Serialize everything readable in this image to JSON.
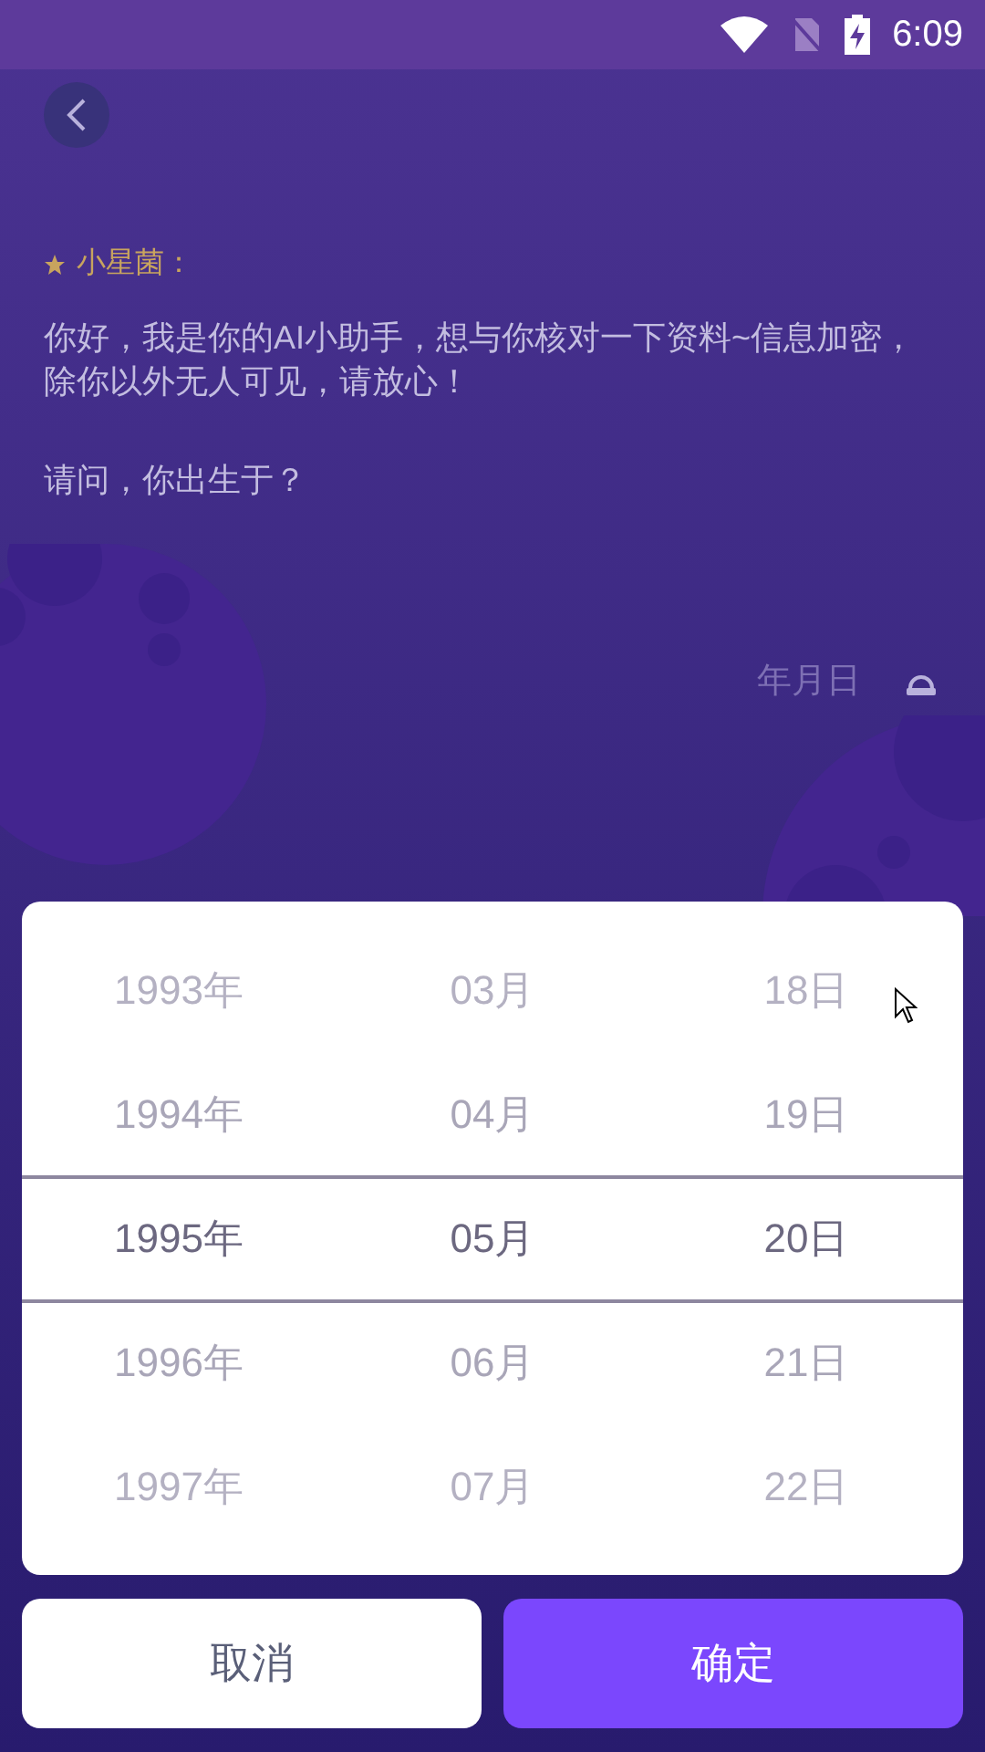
{
  "status_bar": {
    "time": "6:09"
  },
  "assistant": {
    "name": "小星菌：",
    "message": "你好，我是你的AI小助手，想与你核对一下资料~信息加密，除你以外无人可见，请放心！",
    "question": "请问，你出生于？"
  },
  "answer": {
    "placeholder": "年月日"
  },
  "picker": {
    "columns": [
      {
        "items": [
          {
            "label": "1993年",
            "selected": false
          },
          {
            "label": "1994年",
            "selected": false
          },
          {
            "label": "1995年",
            "selected": true
          },
          {
            "label": "1996年",
            "selected": false
          },
          {
            "label": "1997年",
            "selected": false
          }
        ]
      },
      {
        "items": [
          {
            "label": "03月",
            "selected": false
          },
          {
            "label": "04月",
            "selected": false
          },
          {
            "label": "05月",
            "selected": true
          },
          {
            "label": "06月",
            "selected": false
          },
          {
            "label": "07月",
            "selected": false
          }
        ]
      },
      {
        "items": [
          {
            "label": "18日",
            "selected": false
          },
          {
            "label": "19日",
            "selected": false
          },
          {
            "label": "20日",
            "selected": true
          },
          {
            "label": "21日",
            "selected": false
          },
          {
            "label": "22日",
            "selected": false
          }
        ]
      }
    ]
  },
  "buttons": [
    {
      "label": "取消",
      "kind": "cancel"
    },
    {
      "label": "确定",
      "kind": "confirm"
    }
  ]
}
